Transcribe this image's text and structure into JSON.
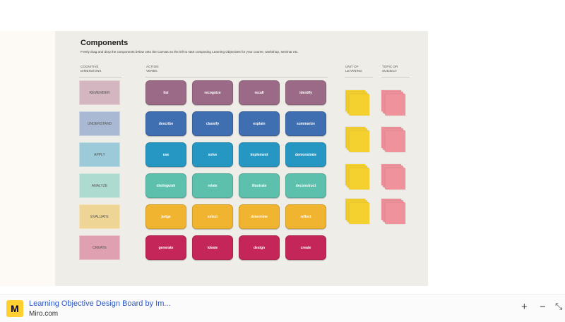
{
  "board": {
    "title": "Components",
    "subtitle": "Freely drag and drop the components below onto the Canvas on the left to start composing Learning Objectives for your course, workshop, seminar etc.",
    "columns": {
      "cognitive": [
        "COGNITIVE",
        "DIMENSIONS"
      ],
      "action": [
        "ACTION",
        "VERBS"
      ],
      "unit": [
        "UNIT OF",
        "LEARNING"
      ],
      "topic": [
        "TOPIC OR",
        "SUBJECT"
      ]
    },
    "dimensions": [
      {
        "label": "REMEMBER",
        "color": "#d3b6bf"
      },
      {
        "label": "UNDERSTAND",
        "color": "#a9b8d3"
      },
      {
        "label": "APPLY",
        "color": "#9ccad8"
      },
      {
        "label": "ANALYZE",
        "color": "#aedbcf"
      },
      {
        "label": "EVALUATE",
        "color": "#efd595"
      },
      {
        "label": "CREATE",
        "color": "#dfa0b1"
      }
    ],
    "verbs": [
      {
        "color": "#9b6a86",
        "items": [
          "list",
          "recognize",
          "recall",
          "identify"
        ]
      },
      {
        "color": "#3f6eb1",
        "items": [
          "describe",
          "classify",
          "explain",
          "summarize"
        ]
      },
      {
        "color": "#2697c3",
        "items": [
          "use",
          "solve",
          "implement",
          "demonstrate"
        ]
      },
      {
        "color": "#5dc0ad",
        "items": [
          "distinguish",
          "relate",
          "illustrate",
          "deconstruct"
        ]
      },
      {
        "color": "#f0b430",
        "items": [
          "judge",
          "select",
          "determine",
          "reflect"
        ]
      },
      {
        "color": "#c42659",
        "items": [
          "generate",
          "ideate",
          "design",
          "create"
        ]
      }
    ],
    "unit_color": "#f5d130",
    "topic_color": "#f0929c"
  },
  "footer": {
    "title": "Learning Objective Design Board by Im...",
    "source": "Miro.com",
    "logo_glyph": "M",
    "zoom_in": "+",
    "zoom_out": "−",
    "fullscreen": "⤡"
  }
}
